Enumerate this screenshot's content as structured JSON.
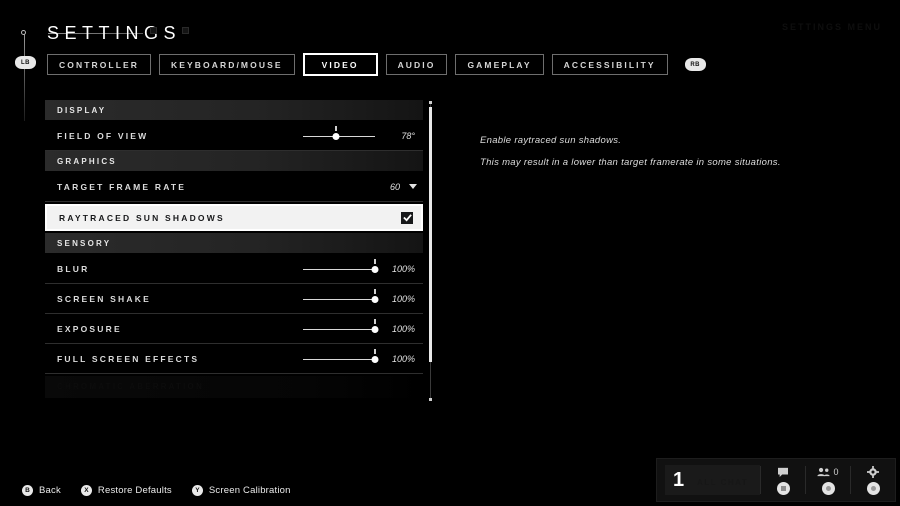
{
  "header": {
    "title": "SETTINGS",
    "ghost_top_right": "SETTINGS MENU",
    "left_bumper": "LB",
    "right_bumper": "RB"
  },
  "tabs": [
    {
      "label": "CONTROLLER",
      "active": false
    },
    {
      "label": "KEYBOARD/MOUSE",
      "active": false
    },
    {
      "label": "VIDEO",
      "active": true
    },
    {
      "label": "AUDIO",
      "active": false
    },
    {
      "label": "GAMEPLAY",
      "active": false
    },
    {
      "label": "ACCESSIBILITY",
      "active": false
    }
  ],
  "settings": {
    "sections": [
      {
        "title": "DISPLAY",
        "rows": [
          {
            "label": "FIELD OF VIEW",
            "type": "slider",
            "value": "78°",
            "percent": 46
          }
        ]
      },
      {
        "title": "GRAPHICS",
        "rows": [
          {
            "label": "TARGET FRAME RATE",
            "type": "dropdown",
            "value": "60"
          },
          {
            "label": "RAYTRACED SUN SHADOWS",
            "type": "checkbox",
            "value": "checked",
            "selected": true
          }
        ]
      },
      {
        "title": "SENSORY",
        "rows": [
          {
            "label": "BLUR",
            "type": "slider",
            "value": "100%",
            "percent": 100
          },
          {
            "label": "SCREEN SHAKE",
            "type": "slider",
            "value": "100%",
            "percent": 100
          },
          {
            "label": "EXPOSURE",
            "type": "slider",
            "value": "100%",
            "percent": 100
          },
          {
            "label": "FULL SCREEN EFFECTS",
            "type": "slider",
            "value": "100%",
            "percent": 100
          }
        ]
      }
    ],
    "partial_row_label": "CHROMATIC ABERRATION"
  },
  "description": {
    "line1": "Enable raytraced sun shadows.",
    "line2": "This may result in a lower than target framerate in some situations."
  },
  "action_bar": [
    {
      "glyph": "B",
      "label": "Back"
    },
    {
      "glyph": "X",
      "label": "Restore Defaults"
    },
    {
      "glyph": "Y",
      "label": "Screen Calibration"
    }
  ],
  "hud": {
    "channel_number": "1",
    "channel_ghost": "ALL CHAT",
    "chat_icon": "chat-bubble-icon",
    "players_icon": "players-icon",
    "players_count": "0",
    "settings_icon": "gear-icon"
  },
  "colors": {
    "background": "#000000",
    "accent": "#ffffff",
    "section_header": "#2b2b2b",
    "selected_row_bg": "#f2f2f2",
    "selected_row_text": "#17181a"
  }
}
